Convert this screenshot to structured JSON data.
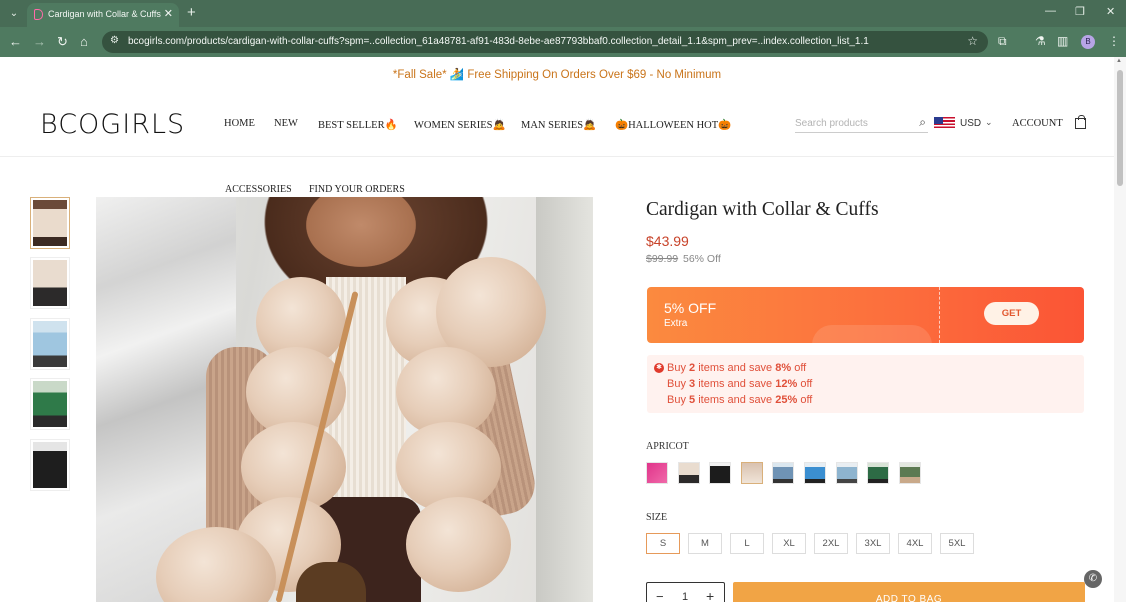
{
  "browser": {
    "tab_title": "Cardigan with Collar & Cuffs",
    "tab_close": "✕",
    "new_tab": "+",
    "url": "bcogirls.com/products/cardigan-with-collar-cuffs?spm=..collection_61a48781-af91-483d-8ebe-ae87793bbaf0.collection_detail_1.1&spm_prev=..index.collection_list_1.1",
    "profile_initial": "B"
  },
  "announcement": "*Fall Sale* 🏄 Free Shipping On Orders Over $69 - No Minimum",
  "header": {
    "logo": "BCOGIRLS",
    "menu": [
      "HOME",
      "NEW",
      "BEST SELLER🔥",
      "WOMEN SERIES🙇",
      "MAN SERIES🙇",
      "🎃HALLOWEEN HOT🎃"
    ],
    "menu_row2": [
      "ACCESSORIES",
      "FIND YOUR ORDERS"
    ],
    "search_placeholder": "Search products",
    "currency": "USD",
    "account": "ACCOUNT"
  },
  "product": {
    "title": "Cardigan with Collar & Cuffs",
    "price": "$43.99",
    "original_price": "$99.99",
    "discount": "56% Off",
    "coupon": {
      "percent": "5% OFF",
      "subtitle": "Extra",
      "button": "GET"
    },
    "tiers": [
      {
        "pre": "Buy ",
        "qty": "2",
        "mid": " items and save ",
        "pct": "8%",
        "post": " off"
      },
      {
        "pre": "Buy ",
        "qty": "3",
        "mid": " items and save ",
        "pct": "12%",
        "post": " off"
      },
      {
        "pre": "Buy ",
        "qty": "5",
        "mid": " items and save ",
        "pct": "25%",
        "post": " off"
      }
    ],
    "color_label": "APRICOT",
    "size_label": "SIZE",
    "sizes": [
      "S",
      "M",
      "L",
      "XL",
      "2XL",
      "3XL",
      "4XL",
      "5XL"
    ],
    "selected_size": "S",
    "quantity": "1",
    "add_to_bag": "ADD TO BAG"
  }
}
